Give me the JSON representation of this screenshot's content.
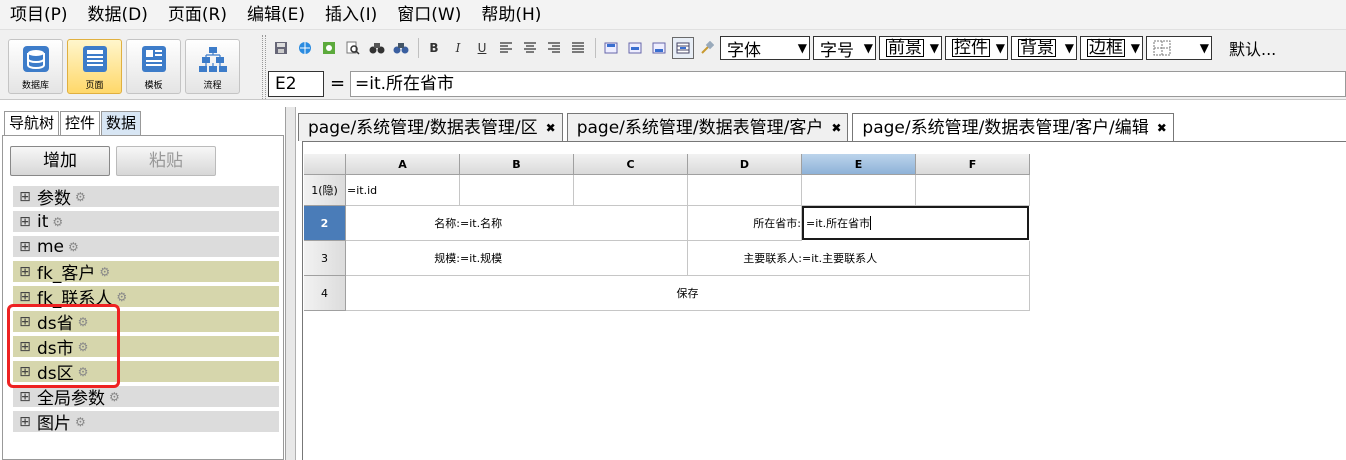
{
  "menu": [
    "项目(P)",
    "数据(D)",
    "页面(R)",
    "编辑(E)",
    "插入(I)",
    "窗口(W)",
    "帮助(H)"
  ],
  "big_buttons": [
    {
      "label": "数据库",
      "icon": "database-icon"
    },
    {
      "label": "页面",
      "icon": "page-icon"
    },
    {
      "label": "模板",
      "icon": "template-icon"
    },
    {
      "label": "流程",
      "icon": "flow-icon"
    }
  ],
  "format_toolbar": {
    "bold": "B",
    "italic": "I",
    "underline": "U",
    "font": "字体",
    "size": "字号",
    "fg": "前景",
    "control": "控件",
    "bg": "背景",
    "border": "边框",
    "default": "默认..."
  },
  "formula_bar": {
    "cell_ref": "E2",
    "equals": "=",
    "formula": "=it.所在省市"
  },
  "left_tabs": [
    "导航树",
    "控件",
    "数据"
  ],
  "left_buttons": {
    "add": "增加",
    "paste": "粘贴"
  },
  "tree": [
    {
      "label": "参数",
      "hl": false
    },
    {
      "label": "it",
      "hl": false
    },
    {
      "label": "me",
      "hl": false
    },
    {
      "label": "fk_客户",
      "hl": true
    },
    {
      "label": "fk_联系人",
      "hl": true
    },
    {
      "label": "ds省",
      "hl": true
    },
    {
      "label": "ds市",
      "hl": true
    },
    {
      "label": "ds区",
      "hl": true
    },
    {
      "label": "全局参数",
      "hl": false
    },
    {
      "label": "图片",
      "hl": false
    }
  ],
  "doc_tabs": [
    {
      "label": "page/系统管理/数据表管理/区",
      "active": false
    },
    {
      "label": "page/系统管理/数据表管理/客户",
      "active": false
    },
    {
      "label": "page/系统管理/数据表管理/客户/编辑",
      "active": true
    }
  ],
  "grid": {
    "columns": [
      "A",
      "B",
      "C",
      "D",
      "E",
      "F"
    ],
    "rows": [
      "1(隐)",
      "2",
      "3",
      "4"
    ],
    "cells": {
      "r1_a": "=it.id",
      "r2_ab_label": "名称:",
      "r2_c": "=it.名称",
      "r2_d": "所在省市:",
      "r2_e": "=it.所在省市",
      "r3_ab_label": "规模:",
      "r3_c": "=it.规模",
      "r3_d": "主要联系人:",
      "r3_e": "=it.主要联系人",
      "r4": "保存"
    }
  }
}
